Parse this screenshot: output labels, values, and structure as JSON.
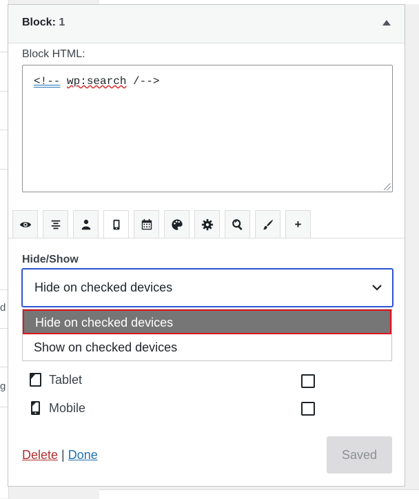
{
  "background": {
    "fragments": [
      "d",
      "g"
    ]
  },
  "widget": {
    "title_label": "Block:",
    "title_number": "1",
    "html_label": "Block HTML:",
    "html_parts": [
      "<!--",
      " ",
      "wp:search",
      " /-->"
    ]
  },
  "tabs": [
    {
      "icon": "eye-icon",
      "title": ""
    },
    {
      "icon": "align-center-icon",
      "title": ""
    },
    {
      "icon": "user-icon",
      "title": ""
    },
    {
      "icon": "mobile-device-icon",
      "title": "",
      "active": true
    },
    {
      "icon": "calendar-icon",
      "title": ""
    },
    {
      "icon": "palette-icon",
      "title": ""
    },
    {
      "icon": "gear-icon",
      "title": ""
    },
    {
      "icon": "search-icon",
      "title": ""
    },
    {
      "icon": "brush-icon",
      "title": ""
    },
    {
      "icon": "plus-icon",
      "title": "+"
    }
  ],
  "hide_show": {
    "label": "Hide/Show",
    "selected": "Hide on checked devices",
    "options": [
      "Hide on checked devices",
      "Show on checked devices"
    ]
  },
  "devices": [
    {
      "label": "Tablet",
      "checked": false
    },
    {
      "label": "Mobile",
      "checked": false
    }
  ],
  "footer": {
    "delete_label": "Delete",
    "separator": "|",
    "done_label": "Done",
    "save_label": "Saved"
  },
  "colors": {
    "focus_blue": "#2c52d4",
    "highlight_red": "#e0121b",
    "highlight_bg": "#767676",
    "delete_red": "#b32d2e",
    "link_blue": "#2271b1"
  }
}
